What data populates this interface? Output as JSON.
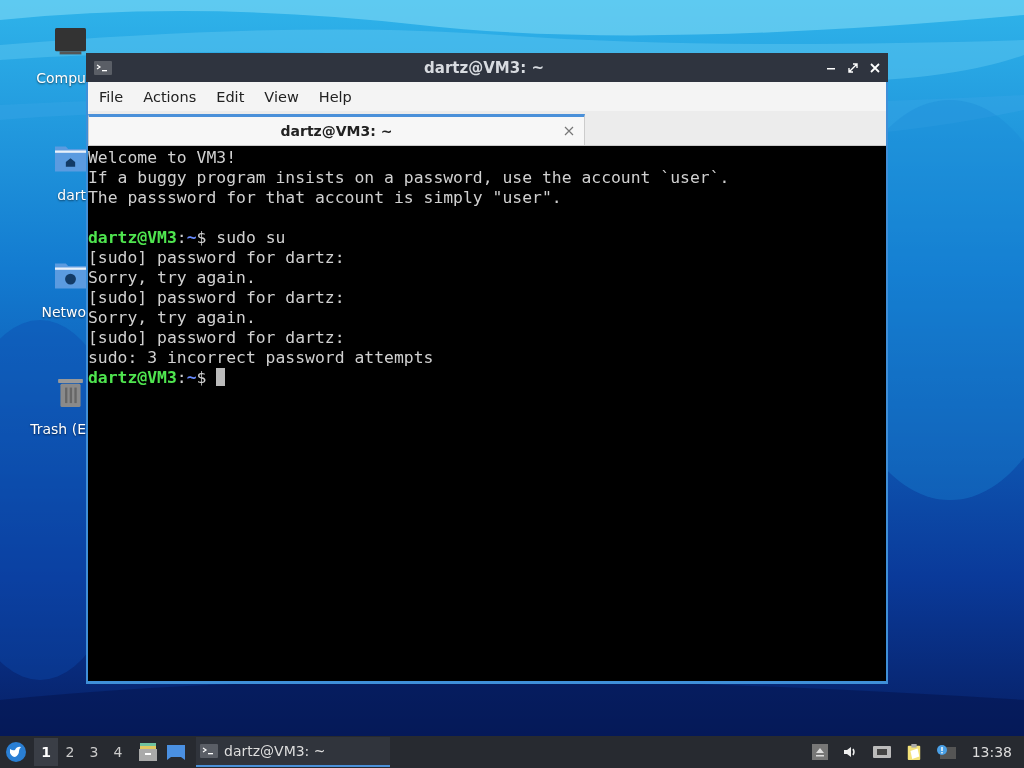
{
  "desktop_icons": [
    {
      "kind": "computer",
      "label": "Compu"
    },
    {
      "kind": "home",
      "label": "dart"
    },
    {
      "kind": "network",
      "label": "Netwo"
    },
    {
      "kind": "trash",
      "label": "Trash (E"
    }
  ],
  "window": {
    "title": "dartz@VM3: ~",
    "menu": [
      "File",
      "Actions",
      "Edit",
      "View",
      "Help"
    ],
    "tabs": [
      {
        "label": "dartz@VM3: ~",
        "selected": true
      }
    ],
    "terminal": [
      {
        "kind": "output",
        "text": "Welcome to VM3!"
      },
      {
        "kind": "output",
        "text": "If a buggy program insists on a password, use the account `user`."
      },
      {
        "kind": "output",
        "text": "The passsword for that account is simply \"user\"."
      },
      {
        "kind": "blank"
      },
      {
        "kind": "prompt",
        "user": "dartz@VM3",
        "sep": ":",
        "path": "~",
        "text": "$ sudo su"
      },
      {
        "kind": "output",
        "text": "[sudo] password for dartz:"
      },
      {
        "kind": "output",
        "text": "Sorry, try again."
      },
      {
        "kind": "output",
        "text": "[sudo] password for dartz:"
      },
      {
        "kind": "output",
        "text": "Sorry, try again."
      },
      {
        "kind": "output",
        "text": "[sudo] password for dartz:"
      },
      {
        "kind": "output",
        "text": "sudo: 3 incorrect password attempts"
      },
      {
        "kind": "prompt",
        "user": "dartz@VM3",
        "sep": ":",
        "path": "~",
        "text": "$ ",
        "cursor": true
      }
    ]
  },
  "taskbar": {
    "workspaces": [
      {
        "label": "1",
        "selected": true
      },
      {
        "label": "2",
        "selected": false
      },
      {
        "label": "3",
        "selected": false
      },
      {
        "label": "4",
        "selected": false
      }
    ],
    "tasks": [
      {
        "label": "dartz@VM3: ~",
        "selected": true
      }
    ],
    "clock": "13:38"
  }
}
